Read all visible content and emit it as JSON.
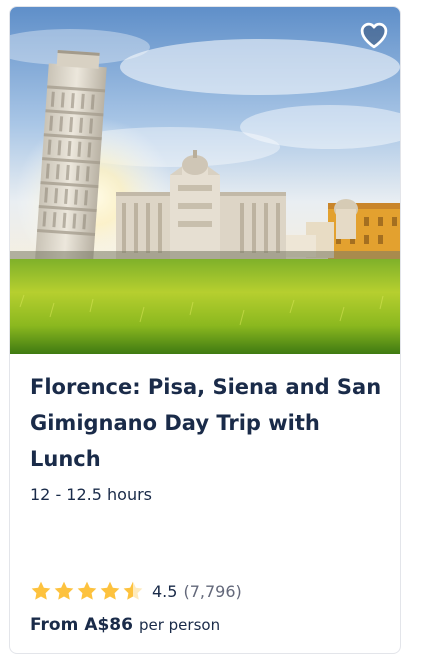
{
  "card": {
    "image_alt": "Leaning Tower of Pisa and cathedral on green lawn",
    "title": "Florence: Pisa, Siena and San Gimignano Day Trip with Lunch",
    "duration": "12 - 12.5 hours",
    "rating": {
      "value": "4.5",
      "reviews": "(7,796)",
      "stars": 4.5,
      "star_color": "#fdc23e"
    },
    "price": {
      "from_label": "From",
      "amount": "A$86",
      "unit": "per person"
    },
    "wishlist_icon": "heart-outline-icon"
  }
}
